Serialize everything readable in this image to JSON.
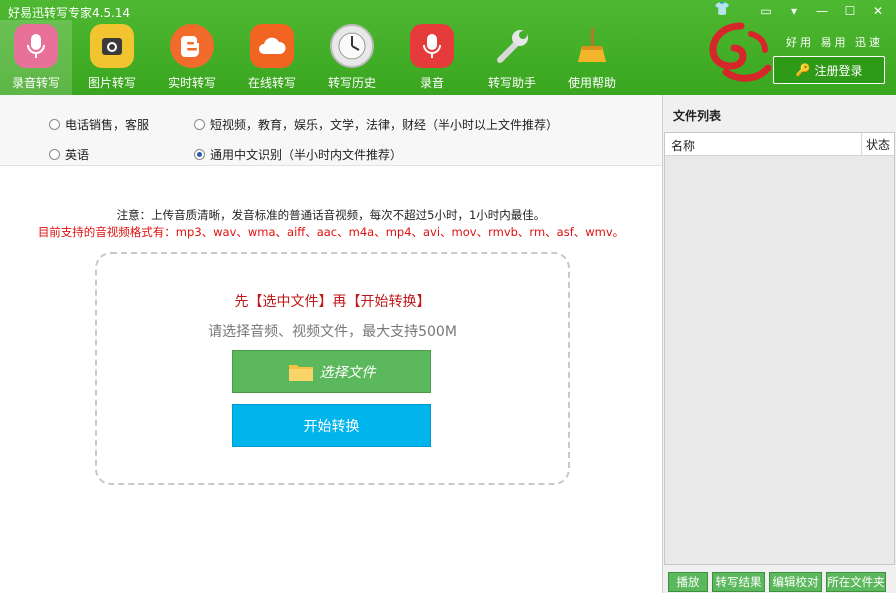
{
  "app": {
    "title": "好易迅转写专家4.5.14"
  },
  "toolbar": {
    "items": [
      {
        "label": "录音转写",
        "icon": "microphone-icon",
        "color": "#e8719a"
      },
      {
        "label": "图片转写",
        "icon": "camera-icon",
        "color": "#f2c530"
      },
      {
        "label": "实时转写",
        "icon": "blogger-icon",
        "color": "#f26b2b"
      },
      {
        "label": "在线转写",
        "icon": "cloud-icon",
        "color": "#f26422"
      },
      {
        "label": "转写历史",
        "icon": "clock-icon",
        "color": "#e8e8e8"
      },
      {
        "label": "录音",
        "icon": "mic-record-icon",
        "color": "#e53b3b"
      },
      {
        "label": "转写助手",
        "icon": "wrench-icon",
        "color": "#d0d0d0"
      },
      {
        "label": "使用帮助",
        "icon": "broom-icon",
        "color": "#f4b42c"
      }
    ]
  },
  "brand": {
    "slogan": "好用 易用 迅速",
    "login_label": "注册登录"
  },
  "options": {
    "o1": "电话销售，客服",
    "o2": "短视频，教育，娱乐，文学，法律，财经（半小时以上文件推荐）",
    "o3": "英语",
    "o4": "通用中文识别（半小时内文件推荐）",
    "selected": "o4"
  },
  "notice": {
    "line1": "注意：上传音质清晰，发音标准的普通话音视频，每次不超过5小时，1小时内最佳。",
    "line2": "目前支持的音视频格式有：mp3、wav、wma、aiff、aac、m4a、mp4、avi、mov、rmvb、rm、asf、wmv。"
  },
  "upload": {
    "title": "先【选中文件】再【开始转换】",
    "subtitle": "请选择音频、视频文件，最大支持500M",
    "select_label": "选择文件",
    "start_label": "开始转换"
  },
  "file_panel": {
    "title": "文件列表",
    "col_name": "名称",
    "col_status": "状态",
    "buttons": [
      "播放",
      "转写结果",
      "编辑校对",
      "所在文件夹"
    ]
  }
}
